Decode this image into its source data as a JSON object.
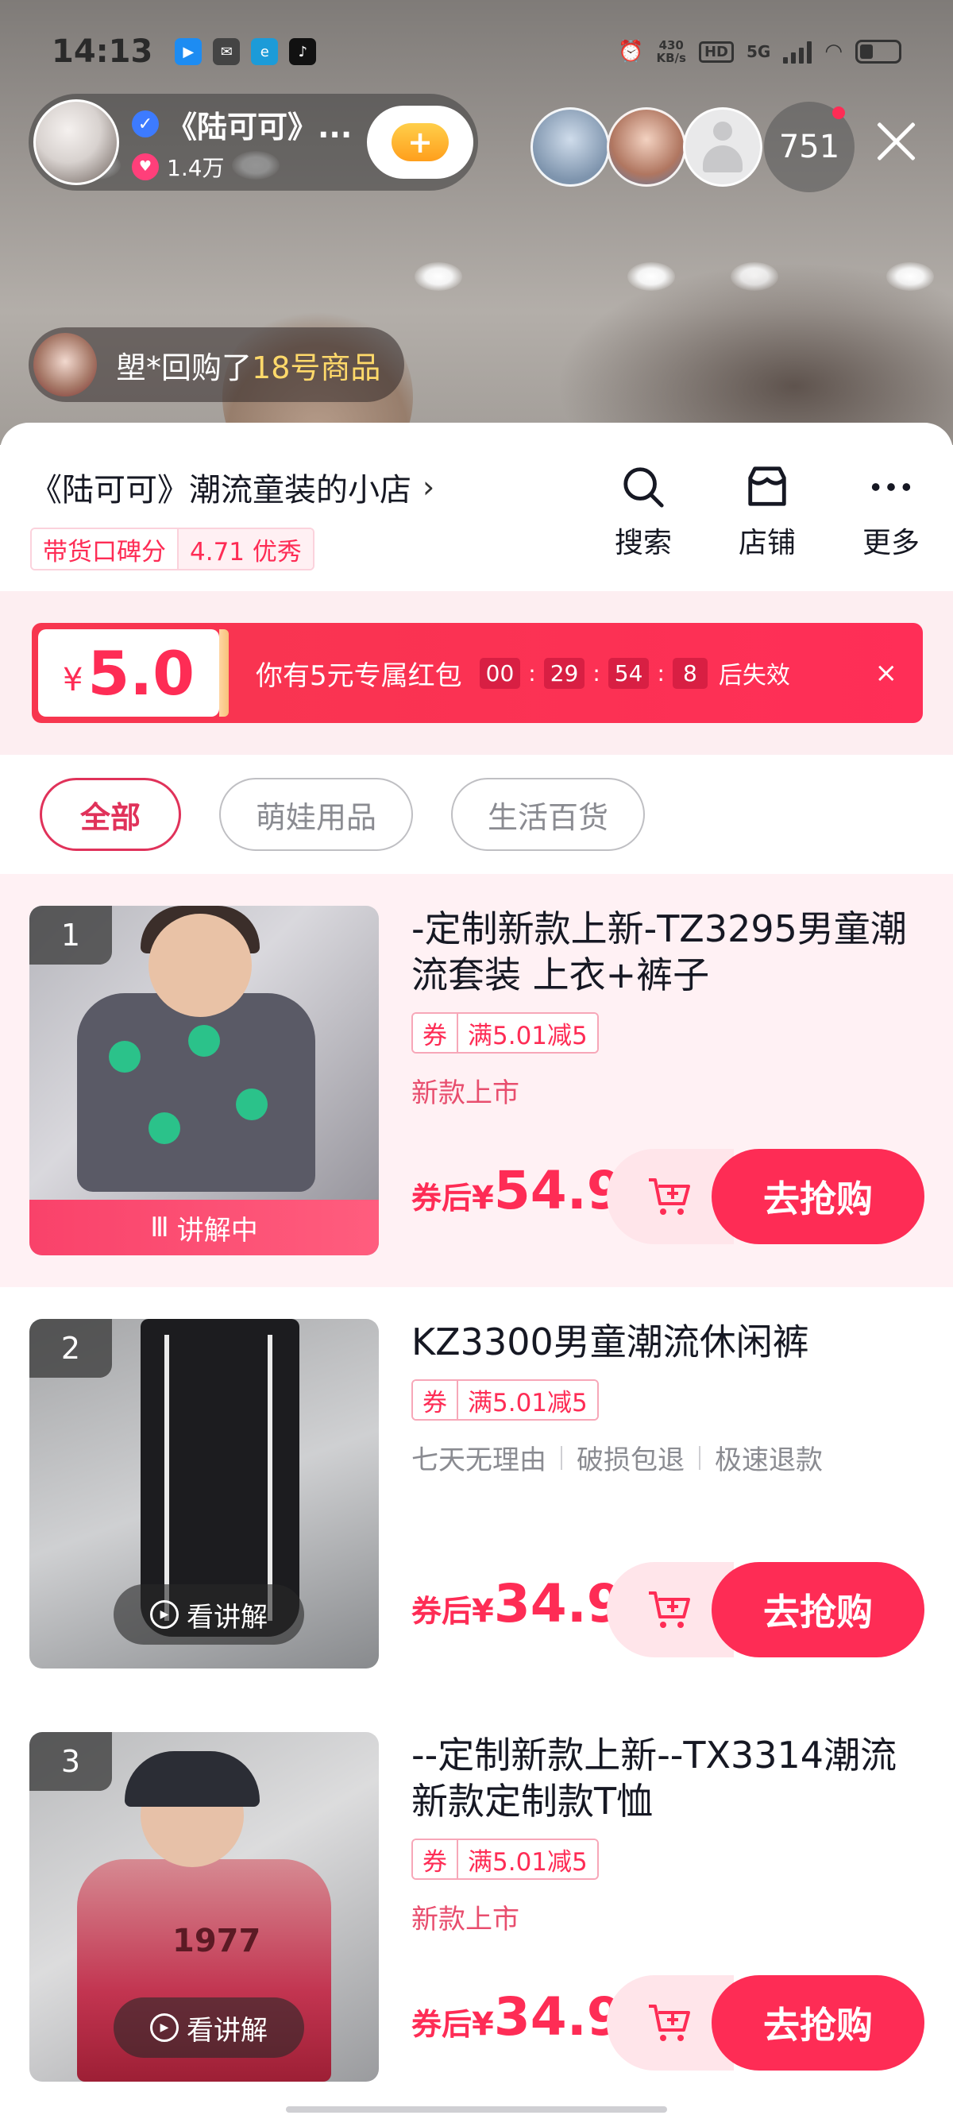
{
  "status_bar": {
    "time": "14:13",
    "net_speed_value": "430",
    "net_speed_unit": "KB/s",
    "hd": "HD",
    "network": "5G"
  },
  "live": {
    "anchor_name": "《陆可可》...",
    "fans": "1.4万",
    "viewer_count": "751",
    "toast_prefix": "塱*回购了",
    "toast_highlight": "18号商品"
  },
  "shop": {
    "name": "《陆可可》潮流童装的小店",
    "rating_label": "带货口碑分",
    "rating_value": "4.71 优秀",
    "actions": {
      "search": "搜索",
      "store": "店铺",
      "more": "更多"
    }
  },
  "coupon": {
    "currency": "¥",
    "amount": "5.0",
    "text": "你有5元专属红包",
    "countdown": {
      "h": "00",
      "m": "29",
      "s": "54",
      "ms": "8"
    },
    "expire": "后失效",
    "close": "×"
  },
  "tabs": [
    {
      "label": "全部",
      "active": true
    },
    {
      "label": "萌娃用品",
      "active": false
    },
    {
      "label": "生活百货",
      "active": false
    }
  ],
  "products": [
    {
      "rank": "1",
      "title": "-定制新款上新-TZ3295男童潮流套装 上衣+裤子",
      "coupon_tag": "券",
      "coupon_rule": "满5.01减5",
      "tagline": "新款上市",
      "badge": "讲解中",
      "price_label": "券后",
      "currency": "¥",
      "price": "54.9",
      "buy_label": "去抢购"
    },
    {
      "rank": "2",
      "title": "KZ3300男童潮流休闲裤",
      "coupon_tag": "券",
      "coupon_rule": "满5.01减5",
      "services": [
        "七天无理由",
        "破损包退",
        "极速退款"
      ],
      "badge": "看讲解",
      "price_label": "券后",
      "currency": "¥",
      "price": "34.9",
      "buy_label": "去抢购"
    },
    {
      "rank": "3",
      "title": "--定制新款上新--TX3314潮流新款定制款T恤",
      "coupon_tag": "券",
      "coupon_rule": "满5.01减5",
      "tagline": "新款上市",
      "print_text": "1977",
      "badge": "看讲解",
      "price_label": "券后",
      "currency": "¥",
      "price": "34.9",
      "buy_label": "去抢购"
    }
  ],
  "colors": {
    "accent": "#fe2c55",
    "coupon_bg": "#f7364f",
    "soft_pink": "#fff1f4"
  }
}
